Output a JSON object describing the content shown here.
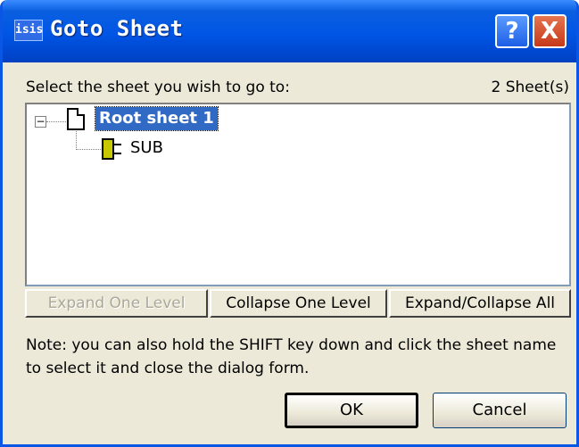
{
  "window": {
    "app_icon_text": "isis",
    "title": "Goto Sheet",
    "help_glyph": "?",
    "close_glyph": "X"
  },
  "header": {
    "instruction": "Select the sheet you wish to go to:",
    "sheet_count": "2 Sheet(s)"
  },
  "tree": {
    "expander_glyph": "−",
    "root_label": "Root sheet 1",
    "child_label": "SUB"
  },
  "tree_buttons": {
    "expand_one": "Expand One Level",
    "collapse_one": "Collapse One Level",
    "expand_collapse_all": "Expand/Collapse All"
  },
  "note": "Note: you can also hold the SHIFT key down and click the sheet name to select it and close the dialog form.",
  "dialog_buttons": {
    "ok": "OK",
    "cancel": "Cancel"
  },
  "colors": {
    "titlebar": "#0055e5",
    "selection": "#316ac5",
    "face": "#ece9d8",
    "sub_icon": "#c8c800"
  }
}
